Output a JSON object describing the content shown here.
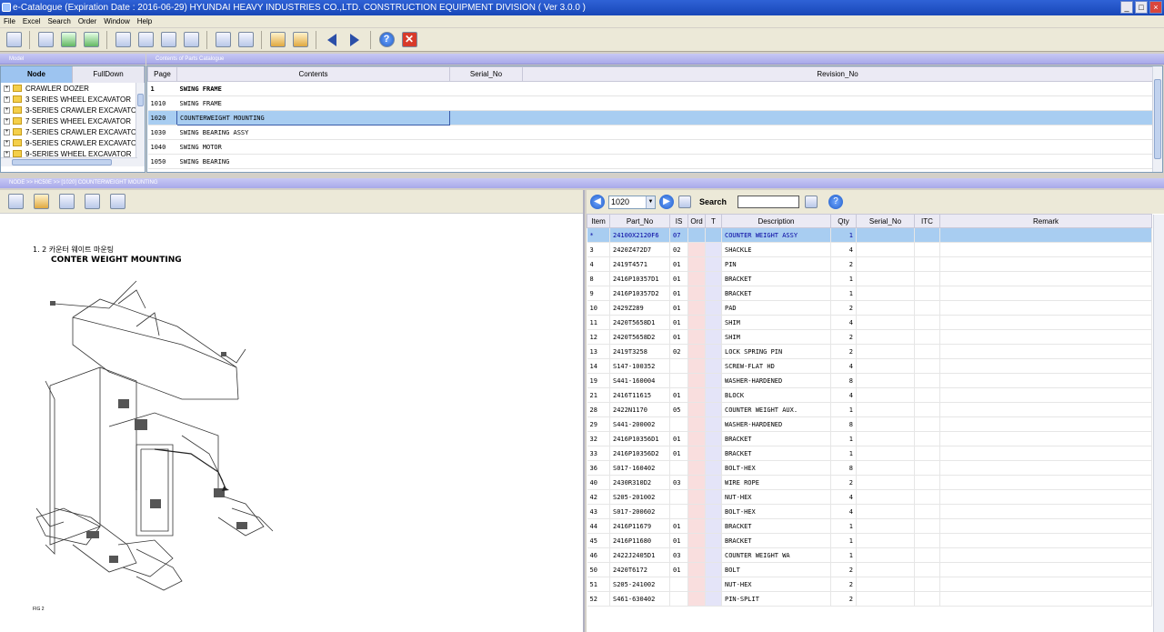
{
  "window": {
    "title": "e-Catalogue (Expiration Date : 2016-06-29)  HYUNDAI HEAVY INDUSTRIES CO.,LTD. CONSTRUCTION EQUIPMENT DIVISION ( Ver 3.0.0 )"
  },
  "menu": [
    "File",
    "Excel",
    "Search",
    "Order",
    "Window",
    "Help"
  ],
  "model_panel": {
    "header": "Model",
    "tabs": [
      "Node",
      "FullDown"
    ],
    "tree": [
      "CRAWLER DOZER",
      "3 SERIES WHEEL EXCAVATOR",
      "3-SERIES CRAWLER EXCAVATO",
      "7 SERIES WHEEL EXCAVATOR",
      "7-SERIES CRAWLER EXCAVATO",
      "9-SERIES CRAWLER EXCAVATO",
      "9-SERIES WHEEL EXCAVATOR"
    ]
  },
  "contents_panel": {
    "header": "Contents of Parts Catalogue",
    "columns": [
      "Page",
      "Contents",
      "Serial_No",
      "Revision_No"
    ],
    "rows": [
      {
        "page": "1",
        "contents": "SWING FRAME"
      },
      {
        "page": "1010",
        "contents": "SWING FRAME"
      },
      {
        "page": "1020",
        "contents": "COUNTERWEIGHT MOUNTING"
      },
      {
        "page": "1030",
        "contents": "SWING BEARING ASSY"
      },
      {
        "page": "1040",
        "contents": "SWING MOTOR"
      },
      {
        "page": "1050",
        "contents": "SWING BEARING"
      }
    ]
  },
  "breadcrumb": "NODE >> HC50E >> [1020] COUNTERWEIGHT MOUNTING",
  "drawing": {
    "title_kr": "1. 2  카운터 웨이트 마운팅",
    "title_en": "CONTER WEIGHT MOUNTING",
    "fig": "FIG 2"
  },
  "parts_toolbar": {
    "page_value": "1020",
    "search_label": "Search"
  },
  "parts_table": {
    "columns": [
      "Item",
      "Part_No",
      "IS",
      "Ord",
      "T",
      "Description",
      "Qty",
      "Serial_No",
      "ITC",
      "Remark"
    ],
    "rows": [
      [
        "*",
        "24100X2120F6",
        "07",
        "COUNTER WEIGHT ASSY",
        "1"
      ],
      [
        "3",
        "2420Z472D7",
        "02",
        "SHACKLE",
        "4"
      ],
      [
        "4",
        "2419T4571",
        "01",
        "PIN",
        "2"
      ],
      [
        "8",
        "2416P10357D1",
        "01",
        "BRACKET",
        "1"
      ],
      [
        "9",
        "2416P10357D2",
        "01",
        "BRACKET",
        "1"
      ],
      [
        "10",
        "2429Z289",
        "01",
        "PAD",
        "2"
      ],
      [
        "11",
        "2420T5658D1",
        "01",
        "SHIM",
        "4"
      ],
      [
        "12",
        "2420T5658D2",
        "01",
        "SHIM",
        "2"
      ],
      [
        "13",
        "2419T3258",
        "02",
        "LOCK SPRING PIN",
        "2"
      ],
      [
        "14",
        "S147-100352",
        "",
        "SCREW-FLAT HD",
        "4"
      ],
      [
        "19",
        "S441-160004",
        "",
        "WASHER-HARDENED",
        "8"
      ],
      [
        "21",
        "2416T11615",
        "01",
        "BLOCK",
        "4"
      ],
      [
        "28",
        "2422N1170",
        "05",
        "COUNTER WEIGHT AUX.",
        "1"
      ],
      [
        "29",
        "S441-200002",
        "",
        "WASHER-HARDENED",
        "8"
      ],
      [
        "32",
        "2416P10356D1",
        "01",
        "BRACKET",
        "1"
      ],
      [
        "33",
        "2416P10356D2",
        "01",
        "BRACKET",
        "1"
      ],
      [
        "36",
        "S017-160402",
        "",
        "BOLT-HEX",
        "8"
      ],
      [
        "40",
        "2430R310D2",
        "03",
        "WIRE ROPE",
        "2"
      ],
      [
        "42",
        "S205-201002",
        "",
        "NUT-HEX",
        "4"
      ],
      [
        "43",
        "S017-200602",
        "",
        "BOLT-HEX",
        "4"
      ],
      [
        "44",
        "2416P11679",
        "01",
        "BRACKET",
        "1"
      ],
      [
        "45",
        "2416P11680",
        "01",
        "BRACKET",
        "1"
      ],
      [
        "46",
        "2422J2405D1",
        "03",
        "COUNTER WEIGHT WA",
        "1"
      ],
      [
        "50",
        "2420T6172",
        "01",
        "BOLT",
        "2"
      ],
      [
        "51",
        "S205-241002",
        "",
        "NUT-HEX",
        "2"
      ],
      [
        "52",
        "S461-630402",
        "",
        "PIN-SPLIT",
        "2"
      ]
    ]
  }
}
